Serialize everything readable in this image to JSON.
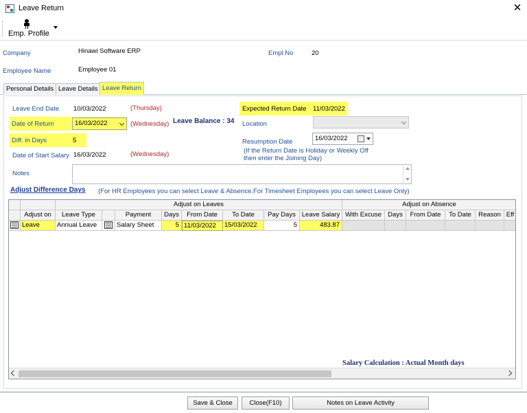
{
  "window": {
    "title": "Leave Return",
    "close_glyph": "✕"
  },
  "toolbar": {
    "emp_profile": "Emp. Profile"
  },
  "header": {
    "company_label": "Company",
    "company_value": "Hinawi Software ERP",
    "emplno_label": "Empl.No",
    "emplno_value": "20",
    "employee_label": "Employee Name",
    "employee_value": "Employee 01"
  },
  "tabs": [
    "Personal Details",
    "Leave Details",
    "Leave Return"
  ],
  "form": {
    "leave_end_date_label": "Leave End Date",
    "leave_end_date": "10/03/2022",
    "leave_end_day": "(Thursday)",
    "expected_return_label": "Expected Return Date",
    "expected_return": "11/03/2022",
    "date_of_return_label": "Date of Return",
    "date_of_return": "16/03/2022",
    "date_of_return_day": "(Wednesday)",
    "leave_balance": "Leave Balance : 34",
    "location_label": "Location",
    "location_value": "",
    "diff_days_label": "Diff. in Days",
    "diff_days": "5",
    "resumption_label": "Resumption Date",
    "resumption_date": "16/03/2022",
    "resumption_note": "(If the Return Date is Holiday or Weekly Off\nthen enter the Joining Day)",
    "start_salary_label": "Date of Start Salary",
    "start_salary": "16/03/2022",
    "start_salary_day": "(Wednesday)",
    "notes_label": "Notes",
    "notes_value": "",
    "adjust_link": "Adjust Difference Days",
    "adjust_hint": "(For HR Employees you can select Leave & Absence.For Timesheet Employees you can select Leave Only)"
  },
  "grid": {
    "group_leaves": "Adjust on Leaves",
    "group_absence": "Adjust on Absence",
    "columns": [
      "Adjust on",
      "Leave Type",
      "Payment",
      "Days",
      "From Date",
      "To Date",
      "Pay Days",
      "Leave Salary",
      "With Excuse",
      "Days",
      "From Date",
      "To Date",
      "Reason",
      "Eff"
    ],
    "rows": [
      {
        "adjust_on": "Leave",
        "leave_type": "Annual Leave",
        "payment": "Salary Sheet",
        "days": "5",
        "from_date": "11/03/2022",
        "to_date": "15/03/2022",
        "pay_days": "5",
        "leave_salary": "483.87"
      }
    ],
    "salary_calc": "Salary Calculation : Actual Month days"
  },
  "footer": {
    "save_close": "Save & Close",
    "close": "Close(F10)",
    "notes_activity": "Notes on Leave Activity"
  },
  "colors": {
    "highlight": "#ffff64",
    "label_blue": "#1f4f9a",
    "day_red": "#a52a2a"
  }
}
